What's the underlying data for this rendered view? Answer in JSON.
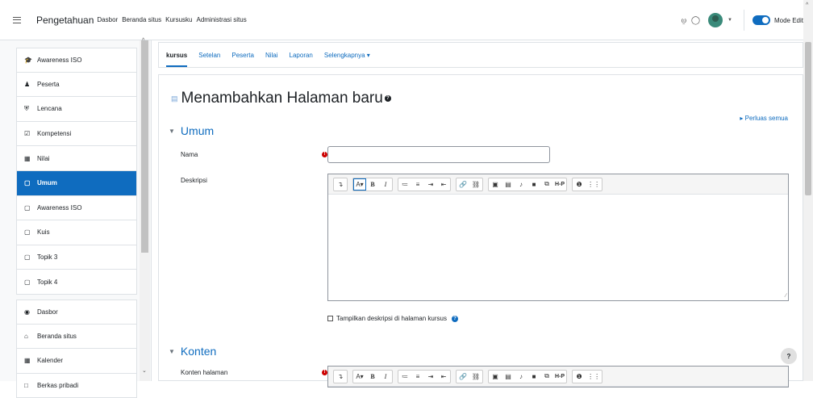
{
  "topbar": {
    "brand": "Pengetahuan",
    "nav": [
      "Dasbor",
      "Beranda situs",
      "Kursusku",
      "Administrasi situs"
    ],
    "edit_mode_label": "Mode Edit",
    "icons": [
      "menu-icon",
      "bell-icon",
      "chat-icon",
      "user-avatar",
      "chevron-down-icon",
      "toggle-switch"
    ]
  },
  "drawer": {
    "items": [
      {
        "label": "Awareness ISO",
        "icon": "graduation-cap-icon"
      },
      {
        "label": "Peserta",
        "icon": "users-icon"
      },
      {
        "label": "Lencana",
        "icon": "shield-icon"
      },
      {
        "label": "Kompetensi",
        "icon": "checkbox-icon"
      },
      {
        "label": "Nilai",
        "icon": "table-icon"
      },
      {
        "label": "Umum",
        "icon": "folder-icon"
      },
      {
        "label": "Awareness ISO",
        "icon": "folder-icon"
      },
      {
        "label": "Kuis",
        "icon": "folder-icon"
      },
      {
        "label": "Topik 3",
        "icon": "folder-icon"
      },
      {
        "label": "Topik 4",
        "icon": "folder-icon"
      },
      {
        "label": "Dasbor",
        "icon": "dashboard-icon"
      },
      {
        "label": "Beranda situs",
        "icon": "home-icon"
      },
      {
        "label": "Kalender",
        "icon": "calendar-icon"
      },
      {
        "label": "Berkas pribadi",
        "icon": "file-icon"
      }
    ]
  },
  "tabs": [
    {
      "label": "kursus",
      "active": true
    },
    {
      "label": "Setelan"
    },
    {
      "label": "Peserta"
    },
    {
      "label": "Nilai"
    },
    {
      "label": "Laporan"
    },
    {
      "label": "Selengkapnya ▾"
    }
  ],
  "page": {
    "title": "Menambahkan Halaman baru",
    "expand_all": "Perluas semua",
    "section_general": "Umum",
    "name_label": "Nama",
    "name_value": "",
    "description_label": "Deskripsi",
    "show_description_label": "Tampilkan deskripsi di halaman kursus",
    "section_content": "Konten",
    "content_label": "Konten halaman",
    "help_fab": "?"
  },
  "editor_toolbar": {
    "groups": [
      [
        "↴"
      ],
      [
        "A▾",
        "B",
        "I"
      ],
      [
        "≔",
        "≡",
        "⇥",
        "⇤"
      ],
      [
        "🔗",
        "⛓"
      ],
      [
        "▣",
        "▤",
        "♪",
        "■",
        "⧉",
        "H-P"
      ],
      [
        "❶",
        "⋮⋮"
      ]
    ]
  },
  "colors": {
    "accent": "#0f6cbf",
    "required": "#cc0000",
    "active_bg": "#0f6cbf"
  }
}
